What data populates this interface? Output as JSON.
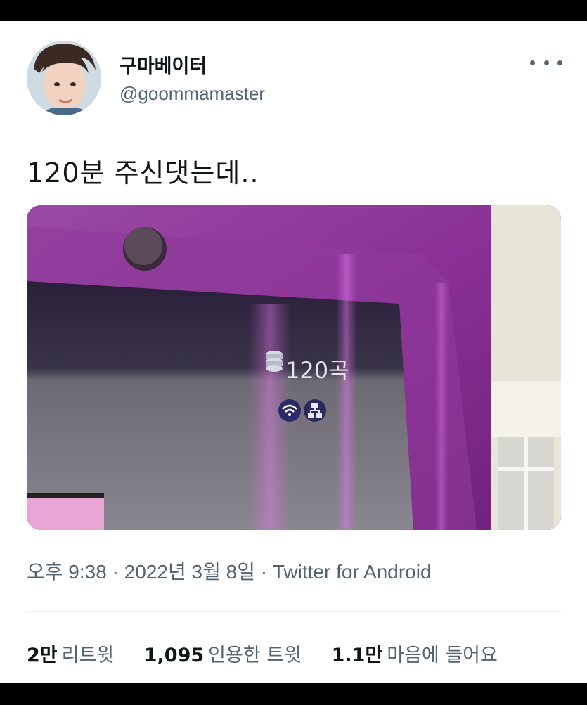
{
  "author": {
    "display_name": "구마베이터",
    "handle": "@goommamaster"
  },
  "tweet": {
    "text": "120분 주신댓는데..",
    "media": {
      "overlay_text": "120곡",
      "icons": [
        "database-icon",
        "wifi-icon",
        "network-icon"
      ]
    }
  },
  "meta": {
    "time": "오후 9:38",
    "separator": " · ",
    "date": "2022년 3월 8일",
    "source": "Twitter for Android"
  },
  "stats": {
    "retweets": {
      "count": "2만",
      "label": "리트윗"
    },
    "quotes": {
      "count": "1,095",
      "label": "인용한 트윗"
    },
    "likes": {
      "count": "1.1만",
      "label": "마음에 들어요"
    }
  },
  "colors": {
    "text_primary": "#0f1419",
    "text_secondary": "#536471",
    "media_purple": "#8a3196"
  }
}
